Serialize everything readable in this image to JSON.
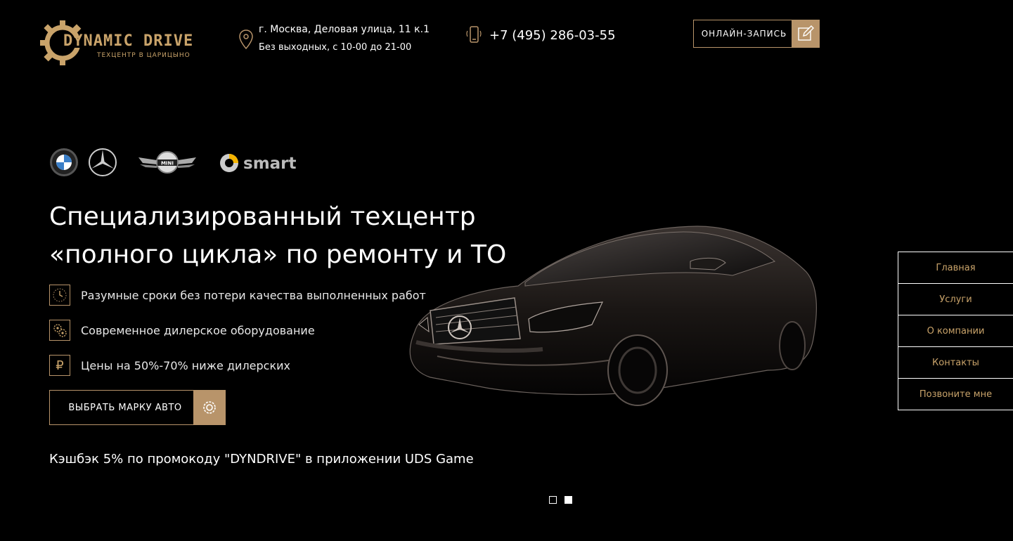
{
  "header": {
    "logo": {
      "brand": "DYNAMIC DRIVE",
      "tagline": "ТЕХЦЕНТР В ЦАРИЦЫНО"
    },
    "address": {
      "line1": "г. Москва, Деловая улица, 11 к.1",
      "line2": "Без выходных, с 10-00 до 21-00",
      "icon": "map-pin-icon"
    },
    "phone": {
      "number": "+7 (495) 286-03-55",
      "icon": "phone-icon"
    },
    "book_button": {
      "label": "ОНЛАЙН-ЗАПИСЬ",
      "icon": "edit-icon"
    }
  },
  "hero": {
    "brands": [
      {
        "name": "bmw",
        "icon": "bmw-logo-icon"
      },
      {
        "name": "mercedes",
        "icon": "mercedes-logo-icon"
      },
      {
        "name": "mini",
        "label": "MINI",
        "icon": "mini-logo-icon"
      },
      {
        "name": "smart",
        "label": "smart",
        "icon": "smart-logo-icon"
      }
    ],
    "title_line1": "Специализированный техцентр",
    "title_line2": "«полного цикла» по ремонту и ТО",
    "features": [
      {
        "text": "Разумные сроки без потери качества выполненных работ",
        "icon": "clock-icon"
      },
      {
        "text": "Современное дилерское оборудование",
        "icon": "gears-icon"
      },
      {
        "text": "Цены на 50%-70% ниже дилерских",
        "icon": "ruble-icon",
        "glyph": "₽"
      }
    ],
    "choose_button": {
      "label": "ВЫБРАТЬ МАРКУ АВТО",
      "icon": "gear-icon"
    },
    "cashback": "Кэшбэк 5% по промокоду \"DYNDRIVE\" в приложении UDS Game",
    "slider": {
      "count": 2,
      "active": 2
    }
  },
  "side_nav": {
    "items": [
      "Главная",
      "Услуги",
      "О компании",
      "Контакты",
      "Позвоните мне"
    ]
  },
  "colors": {
    "accent": "#b8946a",
    "background": "#000000",
    "text": "#ffffff"
  }
}
